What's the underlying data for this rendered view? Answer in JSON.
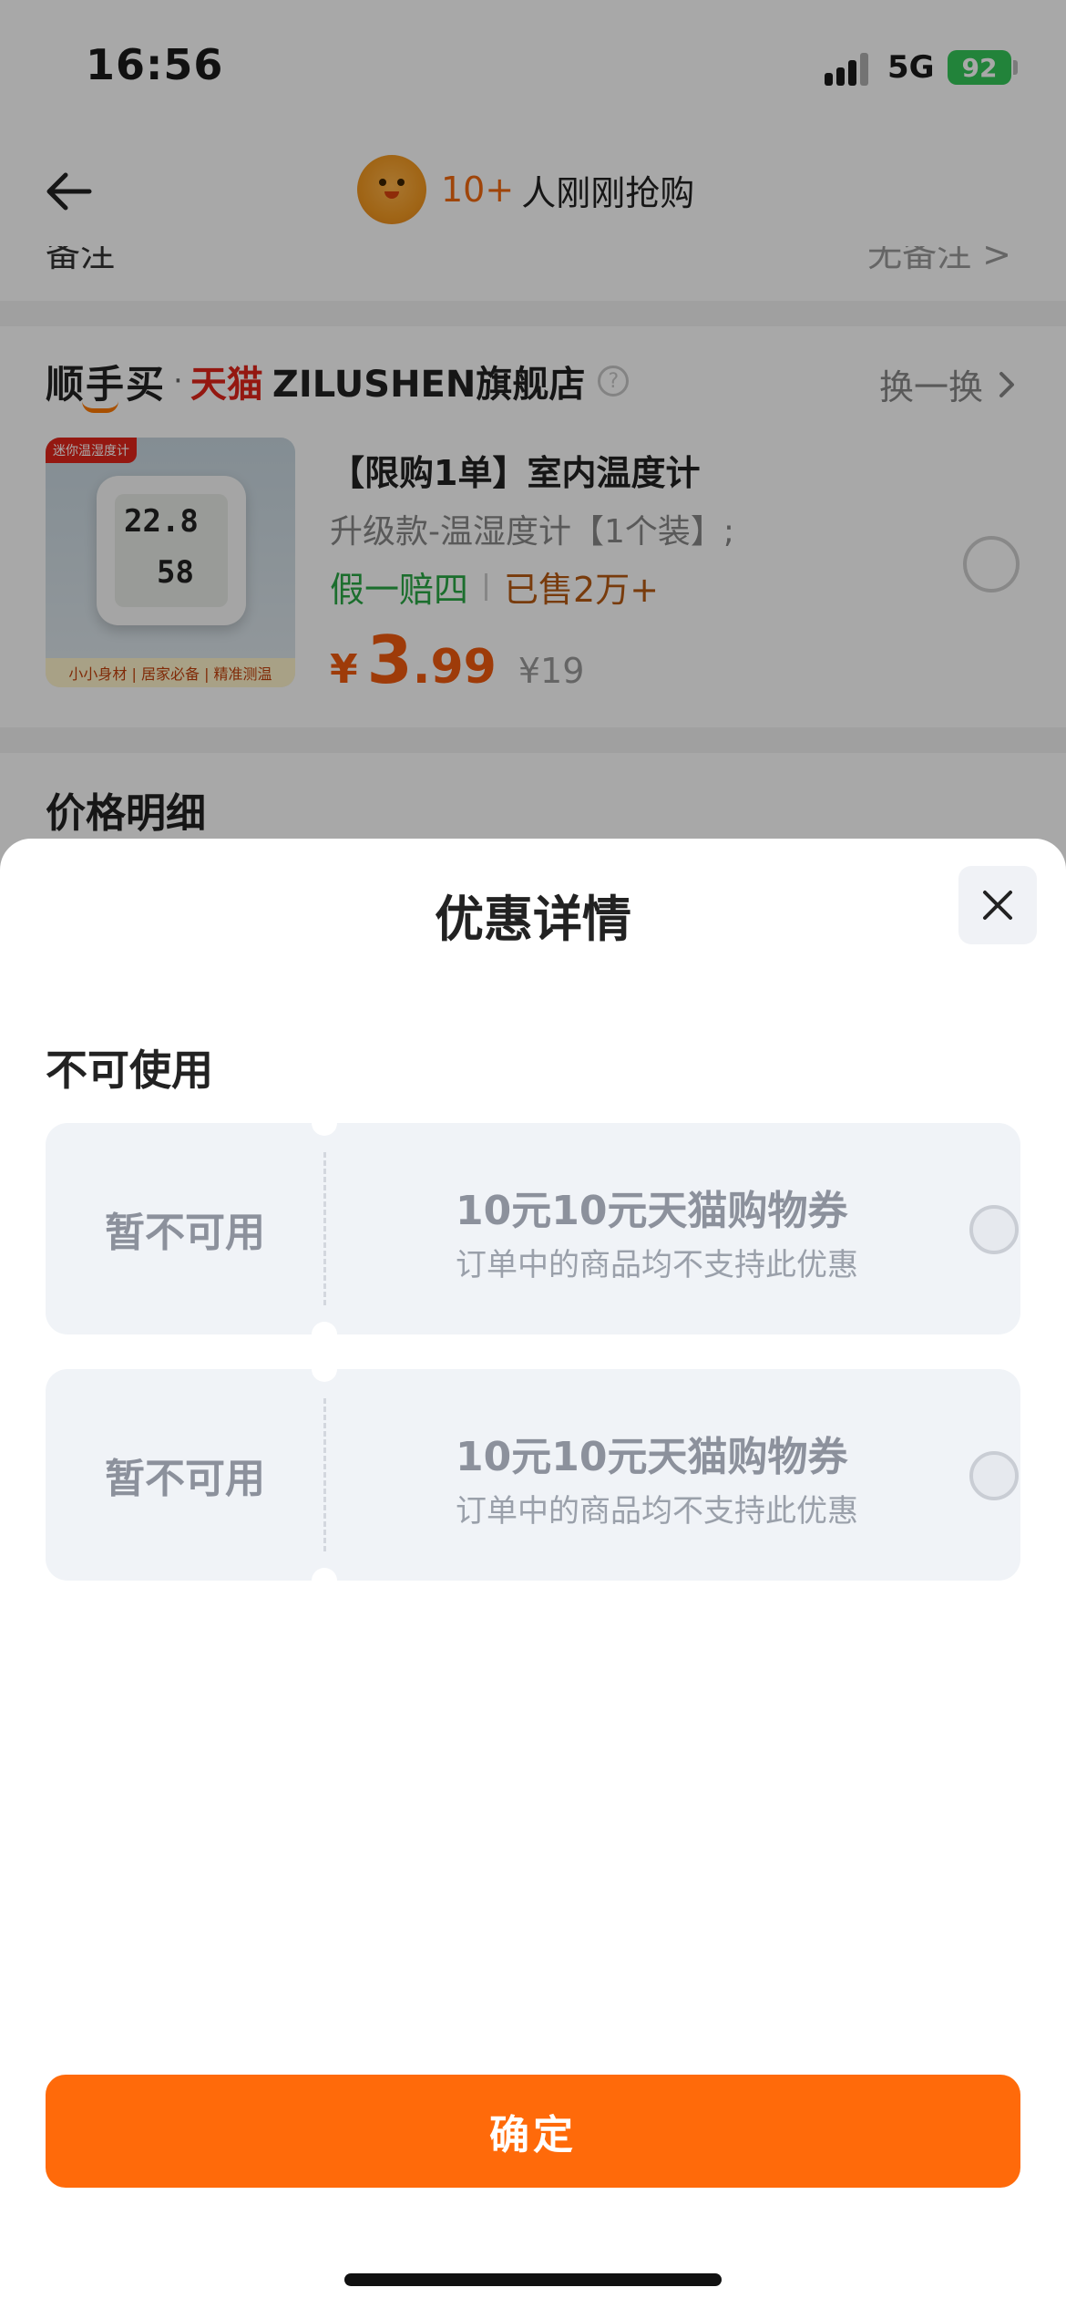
{
  "status_bar": {
    "time": "16:56",
    "network": "5G",
    "battery": "92"
  },
  "nav": {
    "count": "10+",
    "text": "人刚刚抢购"
  },
  "background": {
    "cut_left": "备注",
    "cut_right": "无备注 >"
  },
  "shop": {
    "brand": "顺手买",
    "dot": "·",
    "tmall": "天猫",
    "name": "ZILUSHEN旗舰店",
    "help": "?",
    "swap_label": "换一换"
  },
  "product": {
    "image_tag": "迷你温湿度计",
    "image_caption": "小小身材 | 居家必备 | 精准测温",
    "title": "【限购1单】室内温度计",
    "spec": "升级款-温湿度计【1个装】;",
    "guarantee": "假一赔四",
    "sold": "已售2万+",
    "currency": "¥",
    "price_int": "3",
    "price_dec": ".99",
    "original_price": "¥19"
  },
  "price_section": {
    "title": "价格明细"
  },
  "sheet": {
    "title": "优惠详情",
    "section_label": "不可使用",
    "coupons": [
      {
        "status": "暂不可用",
        "title": "10元10元天猫购物券",
        "desc": "订单中的商品均不支持此优惠"
      },
      {
        "status": "暂不可用",
        "title": "10元10元天猫购物券",
        "desc": "订单中的商品均不支持此优惠"
      }
    ],
    "confirm_label": "确定"
  },
  "colors": {
    "accent": "#ff6a0a",
    "price": "#f05a0f",
    "guarantee": "#2aa845",
    "battery": "#34c759"
  }
}
